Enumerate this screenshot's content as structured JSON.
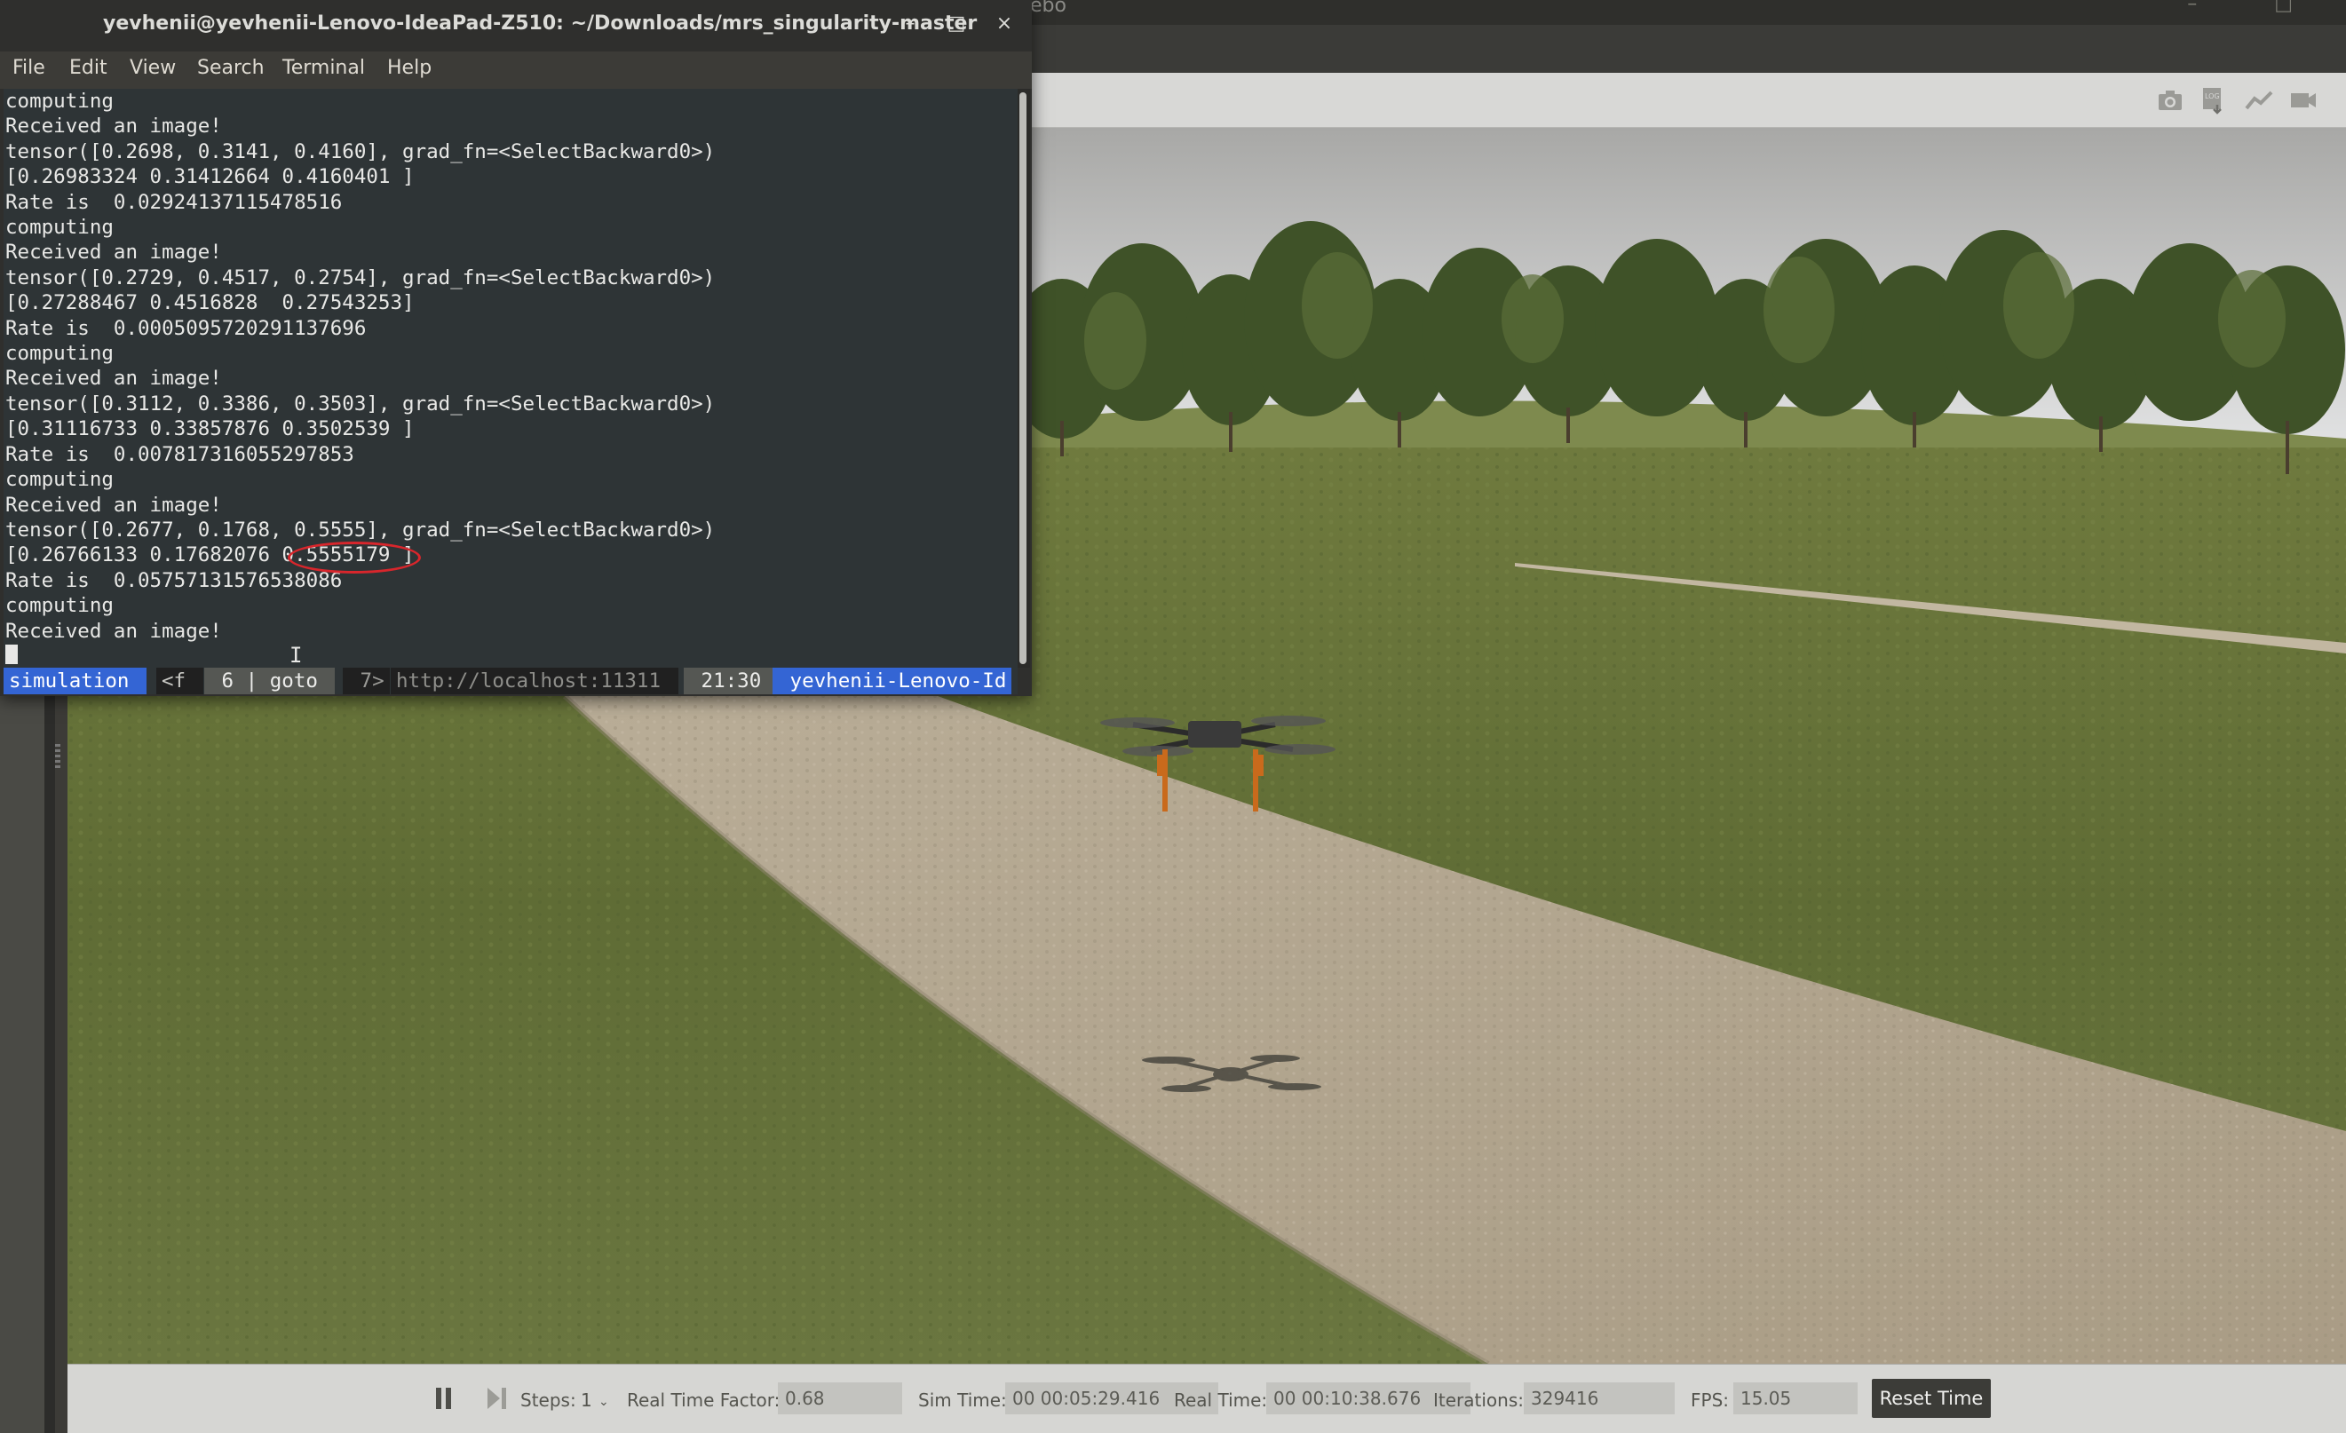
{
  "terminal": {
    "title": "yevhenii@yevhenii-Lenovo-IdeaPad-Z510: ~/Downloads/mrs_singularity-master",
    "window_controls": {
      "minimize": "–",
      "maximize": "□",
      "close": "×"
    },
    "menu": [
      "File",
      "Edit",
      "View",
      "Search",
      "Terminal",
      "Help"
    ],
    "lines": [
      "computing",
      "Received an image!",
      "tensor([0.2698, 0.3141, 0.4160], grad_fn=<SelectBackward0>)",
      "[0.26983324 0.31412664 0.4160401 ]",
      "Rate is  0.02924137115478516",
      "computing",
      "Received an image!",
      "tensor([0.2729, 0.4517, 0.2754], grad_fn=<SelectBackward0>)",
      "[0.27288467 0.4516828  0.27543253]",
      "Rate is  0.0005095720291137696",
      "computing",
      "Received an image!",
      "tensor([0.3112, 0.3386, 0.3503], grad_fn=<SelectBackward0>)",
      "[0.31116733 0.33857876 0.3502539 ]",
      "Rate is  0.007817316055297853",
      "computing",
      "Received an image!",
      "tensor([0.2677, 0.1768, 0.5555], grad_fn=<SelectBackward0>)",
      "[0.26766133 0.17682076 0.5555179 ]",
      "Rate is  0.05757131576538086",
      "computing",
      "Received an image!"
    ],
    "tmux": {
      "session": "simulation ",
      "prev": "<f ",
      "window": " 6 | goto ",
      "next": " 7>",
      "url": "http://localhost:11311 ",
      "time": " 21:30 ",
      "host": " yevhenii-Lenovo-Id"
    }
  },
  "gazebo": {
    "title": "ebo",
    "title_controls": "– □",
    "toolbar_icons": [
      "camera-icon",
      "log-icon",
      "plot-icon",
      "video-icon"
    ],
    "simbar": {
      "steps_label": "Steps:",
      "steps_value": "1",
      "real_time_factor_label": "Real Time Factor:",
      "real_time_factor_value": "0.68",
      "sim_time_label": "Sim Time:",
      "sim_time_value": "00 00:05:29.416",
      "real_time_label": "Real Time:",
      "real_time_value": "00 00:10:38.676",
      "iterations_label": "Iterations:",
      "iterations_value": "329416",
      "fps_label": "FPS:",
      "fps_value": "15.05",
      "reset_label": "Reset Time"
    }
  }
}
